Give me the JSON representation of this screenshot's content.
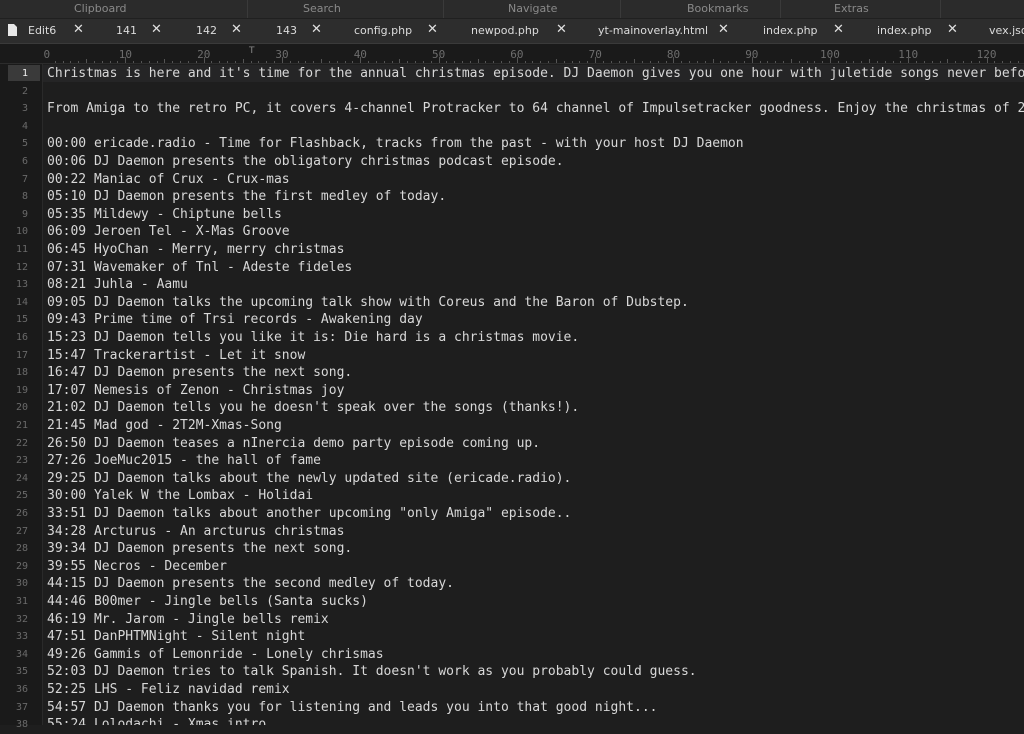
{
  "ribbon": {
    "groups": [
      "Clipboard",
      "Search",
      "Navigate",
      "Bookmarks",
      "Extras"
    ]
  },
  "tabs": [
    {
      "label": "Edit6",
      "close": "✕"
    },
    {
      "label": "141",
      "close": "✕"
    },
    {
      "label": "142",
      "close": "✕"
    },
    {
      "label": "143",
      "close": "✕"
    },
    {
      "label": "config.php",
      "close": "✕"
    },
    {
      "label": "newpod.php",
      "close": "✕"
    },
    {
      "label": "yt-mainoverlay.html",
      "close": "✕"
    },
    {
      "label": "index.php",
      "close": "✕"
    },
    {
      "label": "index.php",
      "close": "✕"
    },
    {
      "label": "vex.jso",
      "close": ""
    }
  ],
  "ruler": {
    "labels": [
      "0",
      "10",
      "20",
      "30",
      "40",
      "50",
      "60",
      "70",
      "80",
      "90",
      "100",
      "110",
      "120"
    ]
  },
  "editor": {
    "current_line": 1,
    "lines": [
      "Christmas is here and it's time for the annual christmas episode. DJ Daemon gives you one hour with juletide songs never befo",
      "",
      "From Amiga to the retro PC, it covers 4-channel Protracker to 64 channel of Impulsetracker goodness. Enjoy the christmas of 2",
      "",
      "00:00 ericade.radio - Time for Flashback, tracks from the past - with your host DJ Daemon",
      "00:06 DJ Daemon presents the obligatory christmas podcast episode.",
      "00:22 Maniac of Crux - Crux-mas",
      "05:10 DJ Daemon presents the first medley of today.",
      "05:35 Mildewy - Chiptune bells",
      "06:09 Jeroen Tel - X-Mas Groove",
      "06:45 HyoChan - Merry, merry christmas",
      "07:31 Wavemaker of Tnl - Adeste fideles",
      "08:21 Juhla - Aamu",
      "09:05 DJ Daemon talks the upcoming talk show with Coreus and the Baron of Dubstep.",
      "09:43 Prime time of Trsi records - Awakening day",
      "15:23 DJ Daemon tells you like it is: Die hard is a christmas movie.",
      "15:47 Trackerartist - Let it snow",
      "16:47 DJ Daemon presents the next song.",
      "17:07 Nemesis of Zenon - Christmas joy",
      "21:02 DJ Daemon tells you he doesn't speak over the songs (thanks!).",
      "21:45 Mad god - 2T2M-Xmas-Song",
      "26:50 DJ Daemon teases a nInercia demo party episode coming up.",
      "27:26 JoeMuc2015 - the hall of fame",
      "29:25 DJ Daemon talks about the newly updated site (ericade.radio).",
      "30:00 Yalek W the Lombax - Holidai",
      "33:51 DJ Daemon talks about another upcoming \"only Amiga\" episode..",
      "34:28 Arcturus - An arcturus christmas",
      "39:34 DJ Daemon presents the next song.",
      "39:55 Necros - December",
      "44:15 DJ Daemon presents the second medley of today.",
      "44:46 B00mer - Jingle bells (Santa sucks)",
      "46:19 Mr. Jarom - Jingle bells remix",
      "47:51 DanPHTMNight - Silent night",
      "49:26 Gammis of Lemonride - Lonely chrismas",
      "52:03 DJ Daemon tries to talk Spanish. It doesn't work as you probably could guess.",
      "52:25 LHS - Feliz navidad remix",
      "54:57 DJ Daemon thanks you for listening and leads you into that good night...",
      "55:24 Lolodachi - Xmas intro"
    ]
  }
}
